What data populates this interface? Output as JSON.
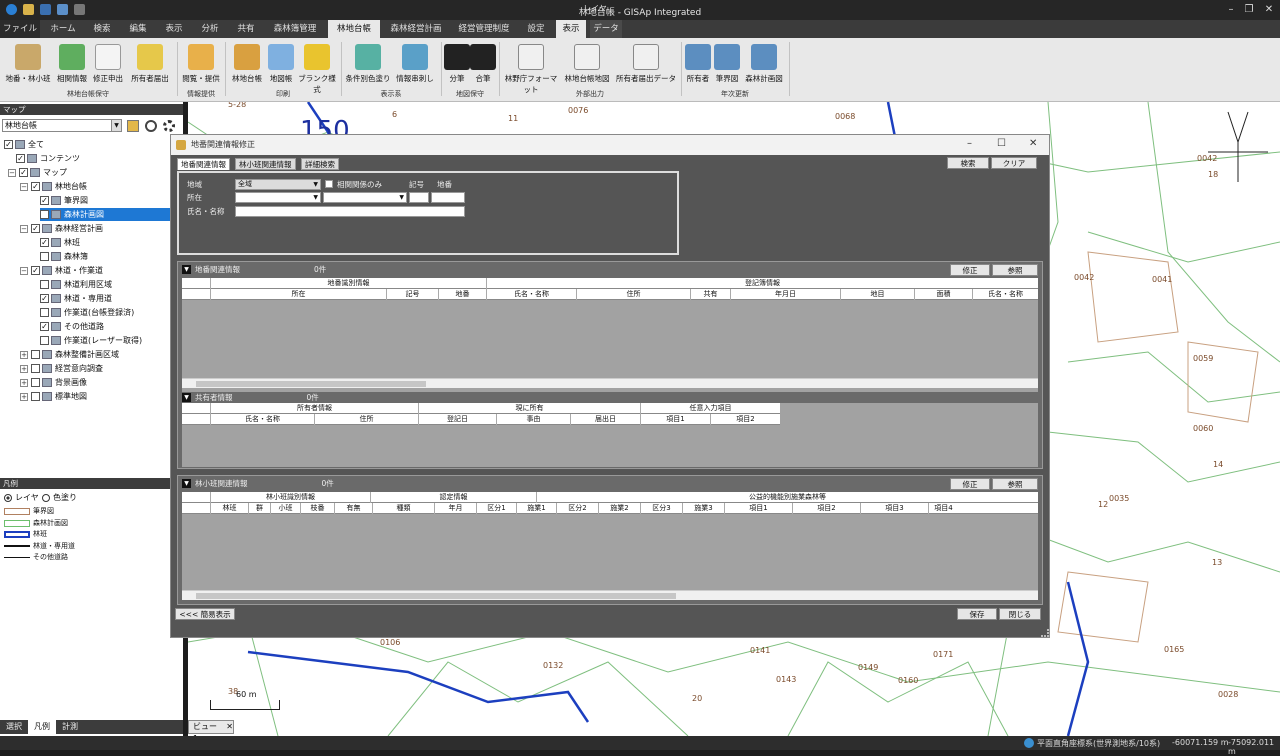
{
  "window": {
    "title": "林地台帳 - GISAp Integrated",
    "context_tab_label": "レイヤ"
  },
  "menu": {
    "tabs": [
      "ファイル",
      "ホーム",
      "検索",
      "編集",
      "表示",
      "分析",
      "共有",
      "森林簿管理",
      "林地台帳",
      "森林経営計画",
      "経営管理制度",
      "設定",
      "表示",
      "データ"
    ]
  },
  "ribbon": {
    "buttons": [
      "地番・林小班",
      "相関情報",
      "修正申出",
      "所有者届出",
      "閲覧・提供",
      "林地台帳",
      "地図帳",
      "ブランク様式",
      "条件別色塗り",
      "情報串刺し",
      "分筆",
      "合筆",
      "林野庁フォーマット",
      "林地台帳地図",
      "所有者届出データ",
      "所有者",
      "筆界図",
      "森林計画図"
    ],
    "groups": [
      "林地台帳保守",
      "情報提供",
      "印刷",
      "表示系",
      "地図保守",
      "外部出力",
      "年次更新"
    ]
  },
  "left_panel": {
    "map_header": "マップ",
    "layer_select": "林地台帳",
    "tree": [
      {
        "label": "全て",
        "checked": true,
        "indent": 0
      },
      {
        "label": "コンテンツ",
        "checked": true,
        "indent": 1
      },
      {
        "label": "マップ",
        "checked": true,
        "indent": 1
      },
      {
        "label": "林地台帳",
        "checked": true,
        "indent": 2
      },
      {
        "label": "筆界図",
        "checked": true,
        "indent": 3
      },
      {
        "label": "森林計画図",
        "checked": true,
        "indent": 3,
        "selected": true
      },
      {
        "label": "森林経営計画",
        "checked": true,
        "indent": 2
      },
      {
        "label": "林班",
        "checked": true,
        "indent": 3
      },
      {
        "label": "森林簿",
        "checked": false,
        "indent": 3
      },
      {
        "label": "林道・作業道",
        "checked": true,
        "indent": 2
      },
      {
        "label": "林道利用区域",
        "checked": false,
        "indent": 3
      },
      {
        "label": "林道・専用道",
        "checked": true,
        "indent": 3
      },
      {
        "label": "作業道(台帳登録済)",
        "checked": false,
        "indent": 3
      },
      {
        "label": "その他道路",
        "checked": true,
        "indent": 3
      },
      {
        "label": "作業道(レーザー取得)",
        "checked": false,
        "indent": 3
      },
      {
        "label": "森林整備計画区域",
        "checked": false,
        "indent": 2
      },
      {
        "label": "経営意向調査",
        "checked": false,
        "indent": 2
      },
      {
        "label": "背景画像",
        "checked": false,
        "indent": 2
      },
      {
        "label": "標準地図",
        "checked": false,
        "indent": 2
      }
    ],
    "legend_header": "凡例",
    "legend_modes": [
      "レイヤ",
      "色塗り"
    ],
    "legend_items": [
      "筆界図",
      "森林計画図",
      "林班",
      "林道・専用道",
      "その他道路"
    ],
    "bottom_tabs": [
      "選択",
      "凡例",
      "計測"
    ]
  },
  "dialog": {
    "title": "地番関連情報修正",
    "tabs": [
      "地番関連情報",
      "林小班関連情報",
      "詳細検索"
    ],
    "search_button": "検索",
    "clear_button": "クリア",
    "form": {
      "region_label": "地域",
      "region_value": "全域",
      "correlation_only": "相関関係のみ",
      "symbol_label": "記号",
      "lot_label": "地番",
      "location_label": "所在",
      "name_label": "氏名・名称"
    },
    "section1": {
      "title": "地番関連情報",
      "count": "0件",
      "edit": "修正",
      "ref": "参照",
      "group1": "地番識別情報",
      "group2": "登記簿情報",
      "columns": [
        "所在",
        "記号",
        "地番",
        "氏名・名称",
        "住所",
        "共有",
        "年月日",
        "地目",
        "面積",
        "氏名・名称"
      ]
    },
    "section2": {
      "title": "共有者情報",
      "count": "0件",
      "groups": [
        "所有者情報",
        "現に所有",
        "任意入力項目"
      ],
      "columns": [
        "氏名・名称",
        "住所",
        "登記日",
        "事由",
        "届出日",
        "項目1",
        "項目2"
      ]
    },
    "section3": {
      "title": "林小班関連情報",
      "count": "0件",
      "edit": "修正",
      "ref": "参照",
      "groups": [
        "林小班識別情報",
        "認定情報",
        "公益的機能別施業森林等"
      ],
      "columns": [
        "林班",
        "群",
        "小班",
        "枝番",
        "有無",
        "種類",
        "年月",
        "区分1",
        "施業1",
        "区分2",
        "施業2",
        "区分3",
        "施業3",
        "項目1",
        "項目2",
        "項目3",
        "項目4"
      ]
    },
    "simple_view": "<<< 簡易表示",
    "save": "保存",
    "close": "閉じる"
  },
  "map": {
    "big_label": "150",
    "labels": [
      "0076",
      "0068",
      "11",
      "6",
      "5-28",
      "0042",
      "18",
      "0042",
      "0041",
      "0059",
      "0060",
      "14",
      "0035",
      "12",
      "0106",
      "0132",
      "0141",
      "0143",
      "0149",
      "0160",
      "0171",
      "0165",
      "20",
      "0028",
      "13",
      "38"
    ],
    "scale": "60 m"
  },
  "view_tab": "ビュー1",
  "status": {
    "crs": "平面直角座標系(世界測地系/10系)",
    "x": "-60071.159 m",
    "y": "-75092.011 m"
  }
}
